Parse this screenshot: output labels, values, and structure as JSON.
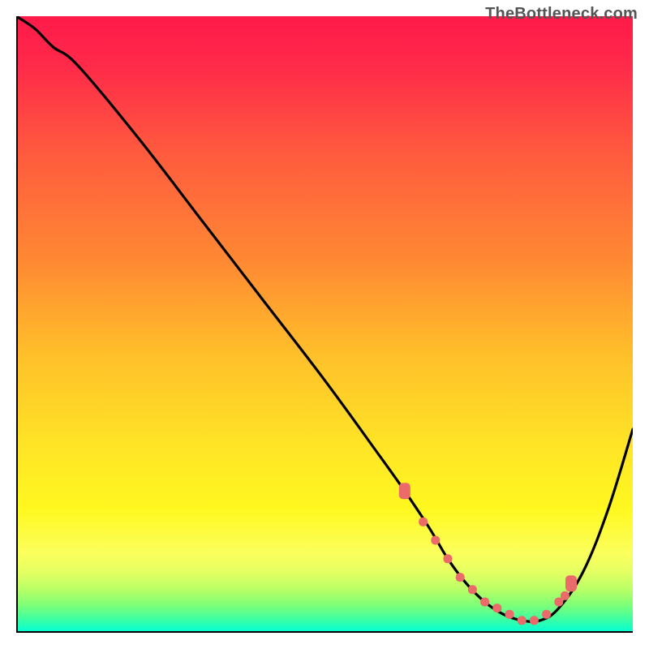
{
  "watermark": "TheBottleneck.com",
  "chart_data": {
    "type": "line",
    "title": "",
    "xlabel": "",
    "ylabel": "",
    "xlim": [
      0,
      100
    ],
    "ylim": [
      0,
      100
    ],
    "grid": false,
    "legend": false,
    "gradient_stops": [
      {
        "offset": 0.0,
        "color": "#ff1a49"
      },
      {
        "offset": 0.08,
        "color": "#ff2a4a"
      },
      {
        "offset": 0.22,
        "color": "#ff5a3e"
      },
      {
        "offset": 0.4,
        "color": "#ff8a33"
      },
      {
        "offset": 0.55,
        "color": "#ffc02a"
      },
      {
        "offset": 0.7,
        "color": "#ffe526"
      },
      {
        "offset": 0.8,
        "color": "#fff820"
      },
      {
        "offset": 0.87,
        "color": "#fbff5c"
      },
      {
        "offset": 0.9,
        "color": "#e6ff62"
      },
      {
        "offset": 0.93,
        "color": "#b8ff66"
      },
      {
        "offset": 0.955,
        "color": "#7eff78"
      },
      {
        "offset": 0.975,
        "color": "#46ff9c"
      },
      {
        "offset": 0.99,
        "color": "#1affc0"
      },
      {
        "offset": 1.0,
        "color": "#00ffd4"
      }
    ],
    "series": [
      {
        "name": "curve",
        "color": "#000000",
        "x": [
          0,
          3,
          6,
          10,
          20,
          30,
          40,
          50,
          58,
          63,
          67,
          70,
          73,
          76,
          79,
          82,
          85,
          88,
          92,
          96,
          100
        ],
        "y": [
          100,
          98,
          95,
          92,
          80,
          67,
          54,
          41,
          30,
          23,
          17,
          12,
          8,
          5,
          3,
          2,
          2,
          4,
          10,
          20,
          33
        ]
      }
    ],
    "markers": {
      "name": "beads",
      "color": "#eb6a6a",
      "points_xy": [
        [
          63,
          23
        ],
        [
          66,
          18
        ],
        [
          68,
          15
        ],
        [
          70,
          12
        ],
        [
          72,
          9
        ],
        [
          74,
          7
        ],
        [
          76,
          5
        ],
        [
          78,
          4
        ],
        [
          80,
          3
        ],
        [
          82,
          2
        ],
        [
          84,
          2
        ],
        [
          86,
          3
        ],
        [
          88,
          5
        ],
        [
          89,
          6
        ],
        [
          90,
          8
        ]
      ]
    },
    "axes": {
      "color": "#000000",
      "width": 4
    }
  }
}
